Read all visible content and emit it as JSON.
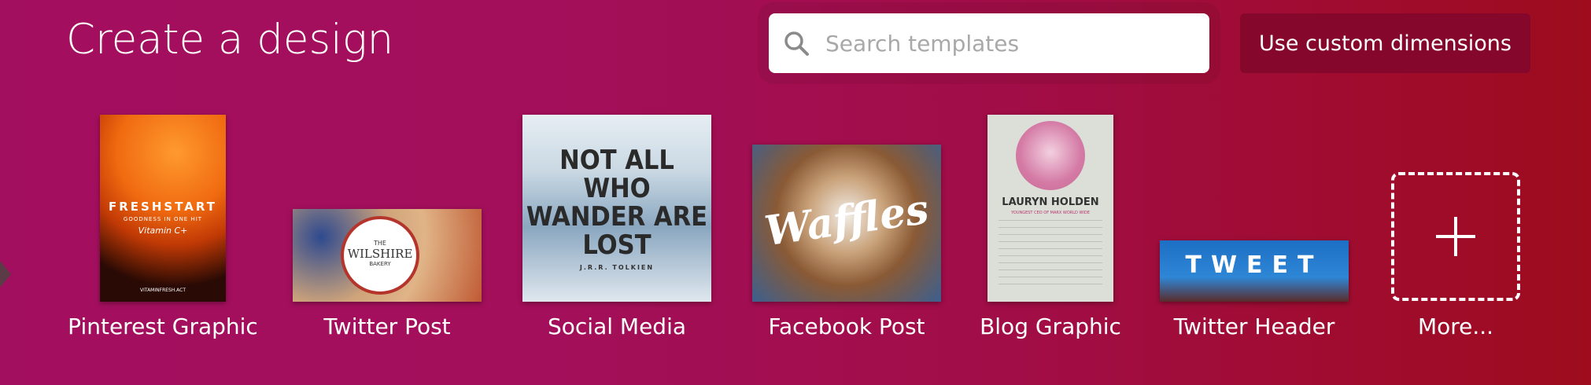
{
  "header": {
    "title": "Create a design",
    "search_placeholder": "Search templates",
    "custom_button": "Use custom dimensions"
  },
  "designs": [
    {
      "label": "Pinterest Graphic",
      "thumb": {
        "brand": "FRESHSTART",
        "subtitle": "GOODNESS IN ONE HIT",
        "accent": "Vitamin C+",
        "footer": "VITAMINFRESH.ACT"
      }
    },
    {
      "label": "Twitter Post",
      "thumb": {
        "small": "THE",
        "name": "WILSHIRE",
        "sub": "BAKERY"
      }
    },
    {
      "label": "Social Media",
      "thumb": {
        "quote": "NOT ALL WHO WANDER ARE LOST",
        "author": "J.R.R. TOLKIEN"
      }
    },
    {
      "label": "Facebook Post",
      "thumb": {
        "word": "Waffles"
      }
    },
    {
      "label": "Blog Graphic",
      "thumb": {
        "name": "LAURYN HOLDEN",
        "role": "YOUNGEST CEO OF MARX WORLD WIDE"
      }
    },
    {
      "label": "Twitter Header",
      "thumb": {
        "word": "TWEET"
      }
    },
    {
      "label": "More..."
    }
  ],
  "colors": {
    "accent_button": "#85072c",
    "background_start": "#a30f5f",
    "background_end": "#9e0c1e"
  }
}
